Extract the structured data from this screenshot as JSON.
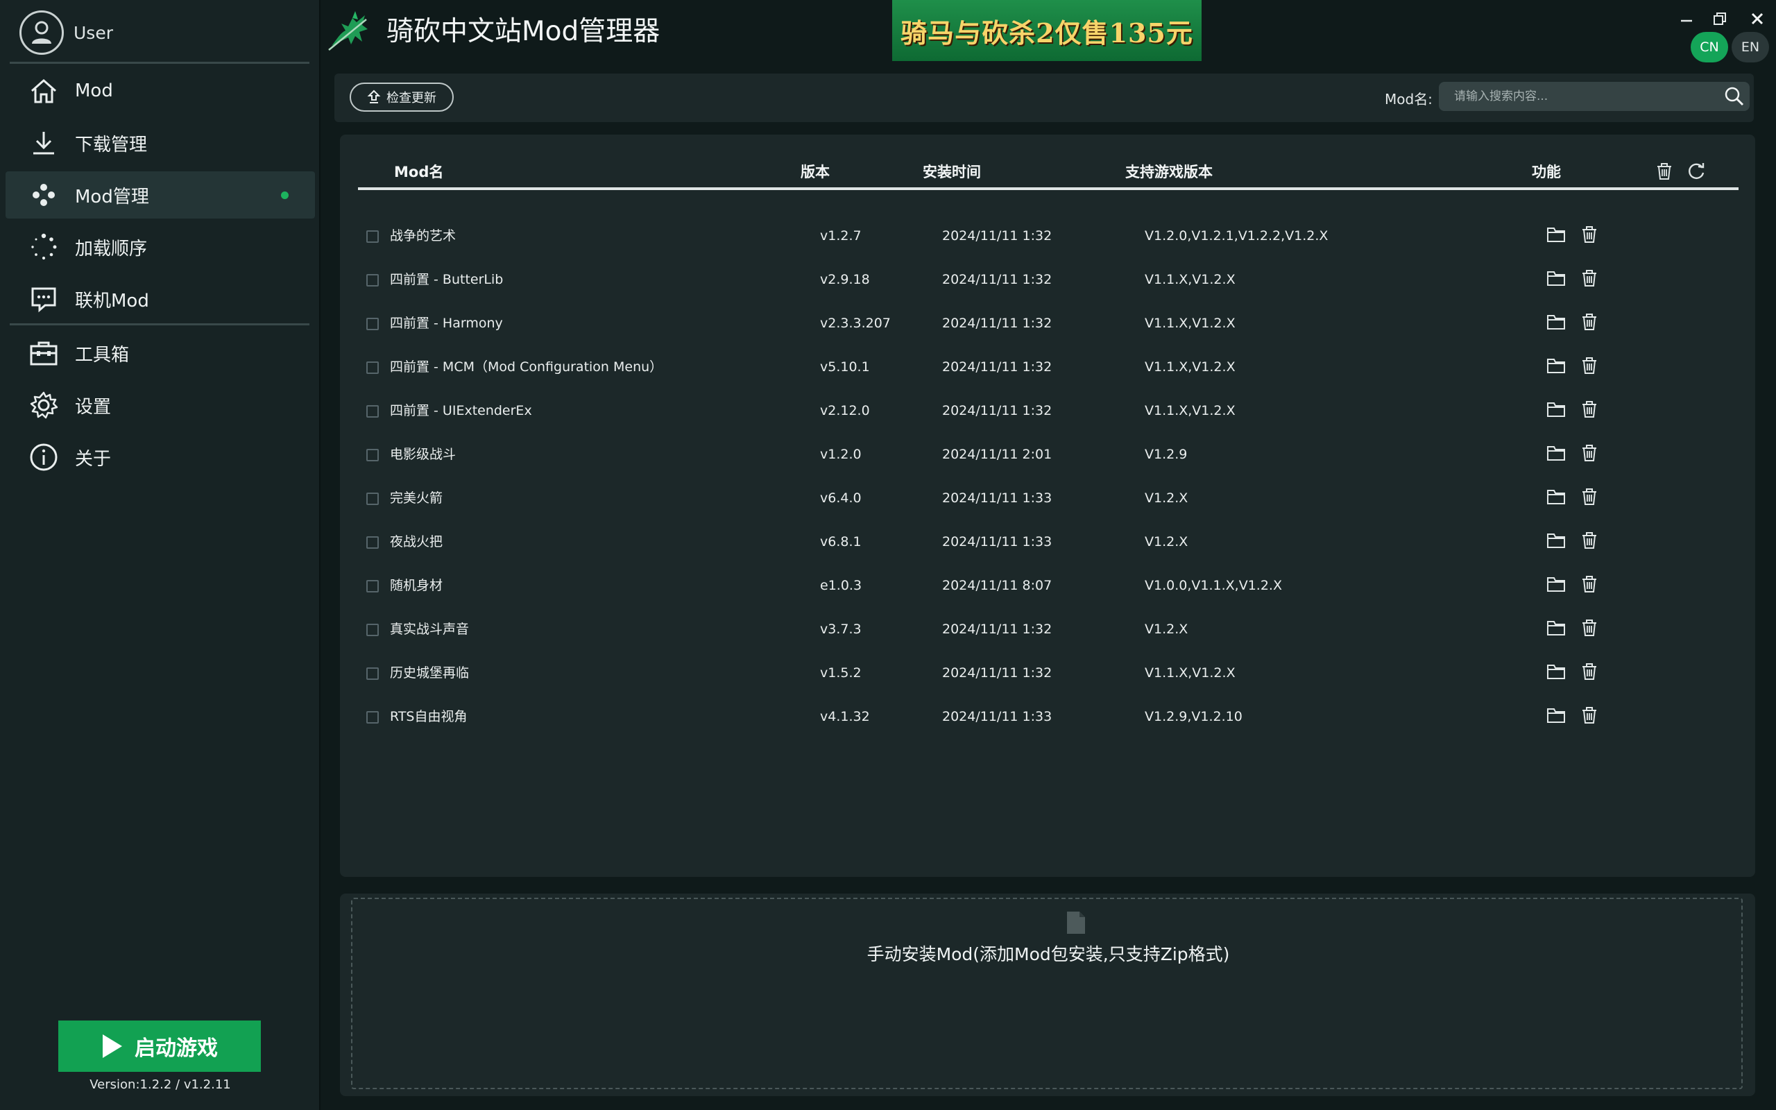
{
  "sidebar": {
    "user_name": "User",
    "nav": [
      {
        "label": "Mod",
        "icon": "home-icon"
      },
      {
        "label": "下载管理",
        "icon": "download-icon"
      },
      {
        "label": "Mod管理",
        "icon": "mod-manage-icon",
        "active": true
      },
      {
        "label": "加载顺序",
        "icon": "load-order-icon"
      },
      {
        "label": "联机Mod",
        "icon": "multiplayer-chat-icon"
      },
      {
        "label": "工具箱",
        "icon": "toolbox-icon"
      },
      {
        "label": "设置",
        "icon": "gear-icon"
      },
      {
        "label": "关于",
        "icon": "info-icon"
      }
    ],
    "launch_label": "启动游戏",
    "version": "Version:1.2.2 / v1.2.11"
  },
  "header": {
    "title": "骑砍中文站Mod管理器",
    "banner_text": "骑马与砍杀2仅售135元",
    "lang_cn": "CN",
    "lang_en": "EN"
  },
  "toolbar": {
    "check_update_label": "检查更新",
    "search_label": "Mod名:",
    "search_placeholder": "请输入搜索内容..."
  },
  "table": {
    "columns": [
      "Mod名",
      "版本",
      "安装时间",
      "支持游戏版本",
      "功能"
    ],
    "rows": [
      {
        "name": "战争的艺术",
        "version": "v1.2.7",
        "installed": "2024/11/11 1:32",
        "game_versions": "V1.2.0,V1.2.1,V1.2.2,V1.2.X"
      },
      {
        "name": "四前置 - ButterLib",
        "version": "v2.9.18",
        "installed": "2024/11/11 1:32",
        "game_versions": "V1.1.X,V1.2.X"
      },
      {
        "name": "四前置 - Harmony",
        "version": "v2.3.3.207",
        "installed": "2024/11/11 1:32",
        "game_versions": "V1.1.X,V1.2.X"
      },
      {
        "name": "四前置 - MCM（Mod Configuration Menu）",
        "version": "v5.10.1",
        "installed": "2024/11/11 1:32",
        "game_versions": "V1.1.X,V1.2.X"
      },
      {
        "name": "四前置 - UIExtenderEx",
        "version": "v2.12.0",
        "installed": "2024/11/11 1:32",
        "game_versions": "V1.1.X,V1.2.X"
      },
      {
        "name": "电影级战斗",
        "version": "v1.2.0",
        "installed": "2024/11/11 2:01",
        "game_versions": "V1.2.9"
      },
      {
        "name": "完美火箭",
        "version": "v6.4.0",
        "installed": "2024/11/11 1:33",
        "game_versions": "V1.2.X"
      },
      {
        "name": "夜战火把",
        "version": "v6.8.1",
        "installed": "2024/11/11 1:33",
        "game_versions": "V1.2.X"
      },
      {
        "name": "随机身材",
        "version": "e1.0.3",
        "installed": "2024/11/11 8:07",
        "game_versions": "V1.0.0,V1.1.X,V1.2.X"
      },
      {
        "name": "真实战斗声音",
        "version": "v3.7.3",
        "installed": "2024/11/11 1:32",
        "game_versions": "V1.2.X"
      },
      {
        "name": "历史城堡再临",
        "version": "v1.5.2",
        "installed": "2024/11/11 1:32",
        "game_versions": "V1.1.X,V1.2.X"
      },
      {
        "name": "RTS自由视角",
        "version": "v4.1.32",
        "installed": "2024/11/11 1:33",
        "game_versions": "V1.2.9,V1.2.10"
      }
    ]
  },
  "dropzone": {
    "label": "手动安装Mod(添加Mod包安装,只支持Zip格式)"
  },
  "colors": {
    "accent": "#12a152",
    "background": "#0f1a1a",
    "panel": "#1c2829",
    "sidebar": "#172324"
  }
}
